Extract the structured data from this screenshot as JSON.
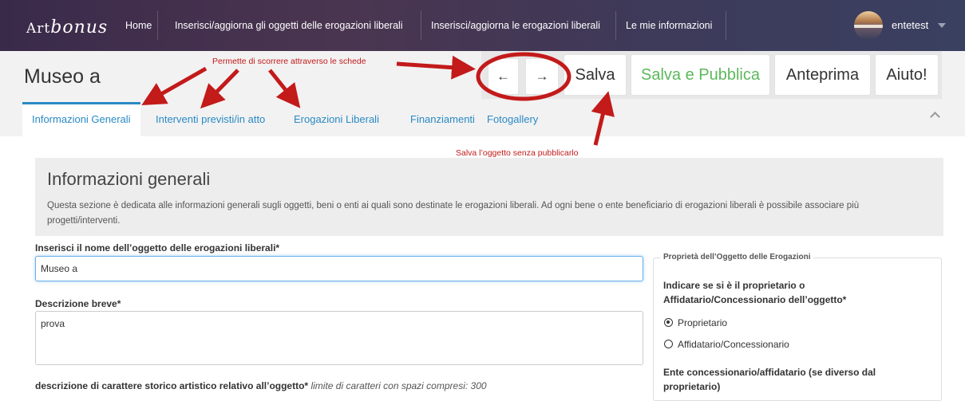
{
  "nav": {
    "logo": {
      "prefix": "Art",
      "suffix": "bonus"
    },
    "items": [
      {
        "label": "Home"
      },
      {
        "label": "Inserisci/aggiorna gli oggetti delle erogazioni liberali"
      },
      {
        "label": "Inserisci/aggiorna le erogazioni liberali"
      },
      {
        "label": "Le mie informazioni"
      }
    ],
    "user": "entetest"
  },
  "header": {
    "title": "Museo a",
    "prev_icon": "arrow-left-icon",
    "next_icon": "arrow-right-icon",
    "save_label": "Salva",
    "save_publish_label": "Salva e Pubblica",
    "preview_label": "Anteprima",
    "help_label": "Aiuto!"
  },
  "tabs": [
    {
      "label": "Informazioni Generali",
      "active": true
    },
    {
      "label": "Interventi previsti/in atto"
    },
    {
      "label": "Erogazioni Liberali"
    },
    {
      "label": "Finanziamenti"
    },
    {
      "label": "Fotogallery"
    }
  ],
  "annotations": {
    "scroll_tabs": "Permette di scorrere attraverso le schede",
    "save_note": "Salva l’oggetto senza pubblicarlo"
  },
  "intro": {
    "heading": "Informazioni generali",
    "text": "Questa sezione è dedicata alle informazioni generali sugli oggetti, beni o enti ai quali sono destinate le erogazioni liberali. Ad ogni bene o ente beneficiario di erogazioni liberali è possibile associare più progetti/interventi."
  },
  "form": {
    "name_label": "Inserisci il nome dell’oggetto delle erogazioni liberali*",
    "name_value": "Museo a",
    "short_desc_label": "Descrizione breve*",
    "short_desc_value": "prova",
    "history_label": "descrizione di carattere storico artistico relativo all’oggetto*",
    "history_hint": "limite di caratteri con spazi compresi: 300"
  },
  "ownership": {
    "legend": "Proprietà dell’Oggetto delle Erogazioni",
    "question": "Indicare se si è il proprietario o Affidatario/Concessionario dell’oggetto*",
    "options": [
      {
        "label": "Proprietario",
        "selected": true
      },
      {
        "label": "Affidatario/Concessionario",
        "selected": false
      }
    ],
    "concessionaire_label": "Ente concessionario/affidatario (se diverso dal proprietario)"
  },
  "colors": {
    "accent": "#2a8ac4",
    "publish_green": "#5cb85c",
    "annotation_red": "#c31a1a"
  }
}
